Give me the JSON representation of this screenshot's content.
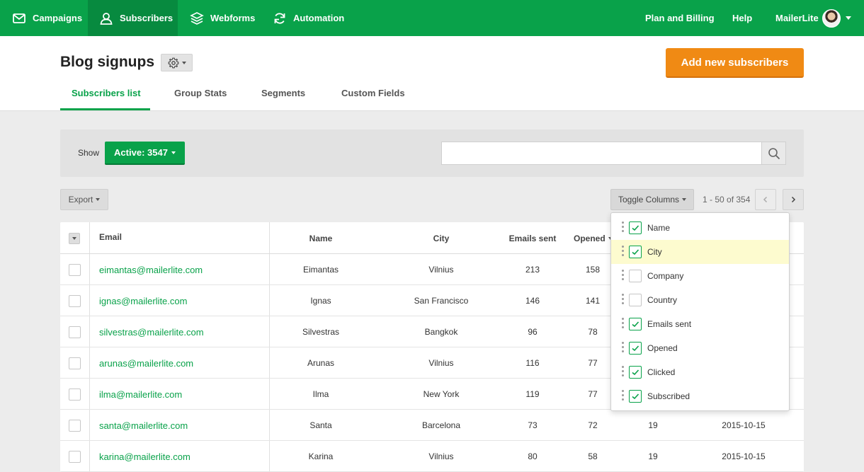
{
  "nav": {
    "items": [
      {
        "label": "Campaigns",
        "icon": "envelope-icon"
      },
      {
        "label": "Subscribers",
        "icon": "user-icon"
      },
      {
        "label": "Webforms",
        "icon": "layers-icon"
      },
      {
        "label": "Automation",
        "icon": "refresh-icon"
      }
    ],
    "right": {
      "plan": "Plan and Billing",
      "help": "Help",
      "account": "MailerLite"
    }
  },
  "header": {
    "title": "Blog signups",
    "add_button": "Add new subscribers",
    "tabs": [
      "Subscribers list",
      "Group Stats",
      "Segments",
      "Custom Fields"
    ],
    "active_tab": "Subscribers list"
  },
  "filter": {
    "show_label": "Show",
    "active_button": "Active: 3547",
    "search_value": ""
  },
  "toolbar": {
    "export": "Export",
    "toggle_columns": "Toggle Columns",
    "pagination": "1 - 50 of 354"
  },
  "table": {
    "headers": {
      "email": "Email",
      "name": "Name",
      "city": "City",
      "emails_sent": "Emails sent",
      "opened": "Opened"
    },
    "rows": [
      {
        "email": "eimantas@mailerlite.com",
        "name": "Eimantas",
        "city": "Vilnius",
        "sent": "213",
        "opened": "158",
        "clicked": "",
        "subscribed": ""
      },
      {
        "email": "ignas@mailerlite.com",
        "name": "Ignas",
        "city": "San Francisco",
        "sent": "146",
        "opened": "141",
        "clicked": "",
        "subscribed": ""
      },
      {
        "email": "silvestras@mailerlite.com",
        "name": "Silvestras",
        "city": "Bangkok",
        "sent": "96",
        "opened": "78",
        "clicked": "",
        "subscribed": ""
      },
      {
        "email": "arunas@mailerlite.com",
        "name": "Arunas",
        "city": "Vilnius",
        "sent": "116",
        "opened": "77",
        "clicked": "",
        "subscribed": ""
      },
      {
        "email": "ilma@mailerlite.com",
        "name": "Ilma",
        "city": "New York",
        "sent": "119",
        "opened": "77",
        "clicked": "",
        "subscribed": ""
      },
      {
        "email": "santa@mailerlite.com",
        "name": "Santa",
        "city": "Barcelona",
        "sent": "73",
        "opened": "72",
        "clicked": "19",
        "subscribed": "2015-10-15"
      },
      {
        "email": "karina@mailerlite.com",
        "name": "Karina",
        "city": "Vilnius",
        "sent": "80",
        "opened": "58",
        "clicked": "19",
        "subscribed": "2015-10-15"
      }
    ]
  },
  "columns_menu": {
    "items": [
      {
        "label": "Name",
        "checked": true
      },
      {
        "label": "City",
        "checked": true
      },
      {
        "label": "Company",
        "checked": false
      },
      {
        "label": "Country",
        "checked": false
      },
      {
        "label": "Emails sent",
        "checked": true
      },
      {
        "label": "Opened",
        "checked": true
      },
      {
        "label": "Clicked",
        "checked": true
      },
      {
        "label": "Subscribed",
        "checked": true
      }
    ]
  },
  "colors": {
    "brand_green": "#09a24a",
    "accent_orange": "#f08a14",
    "highlight": "#fdfbcf"
  }
}
